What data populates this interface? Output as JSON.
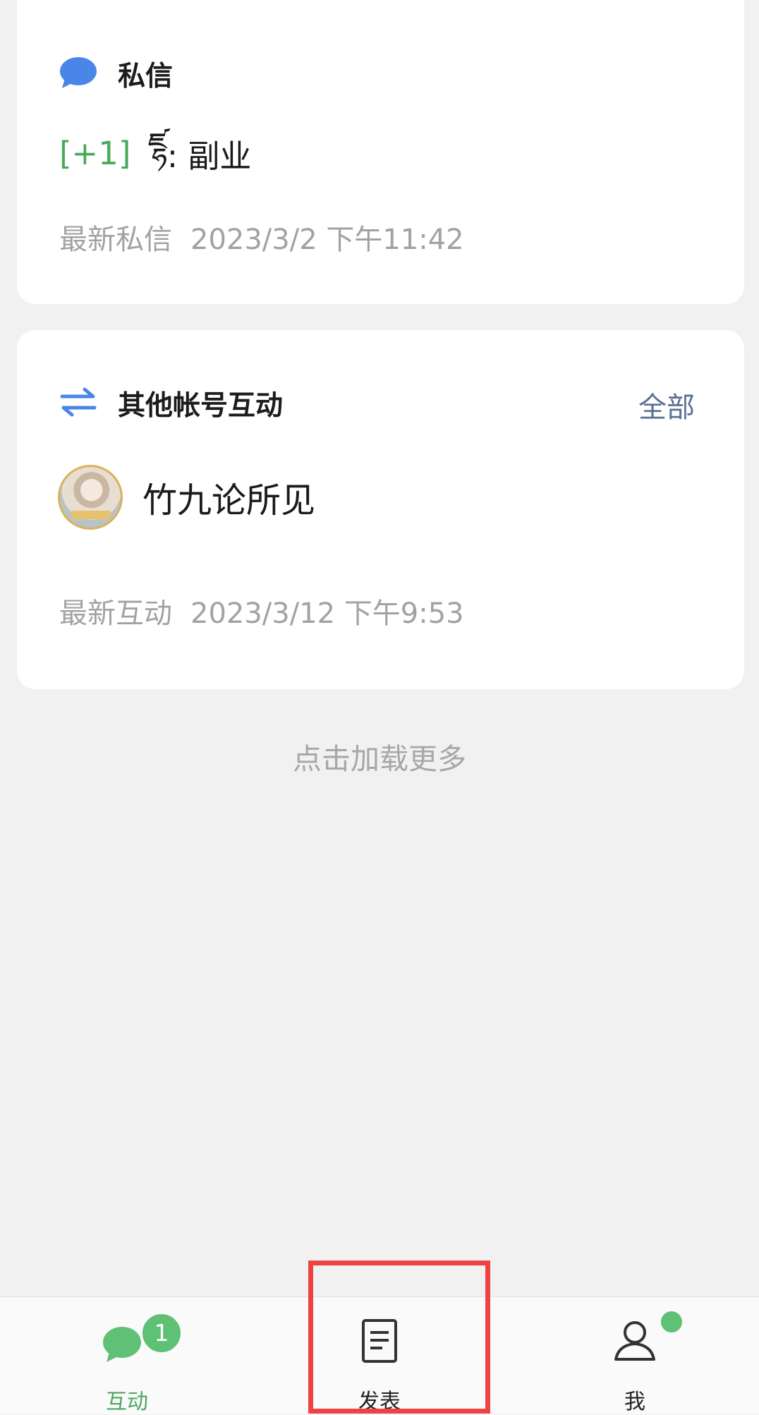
{
  "dm_card": {
    "title": "私信",
    "icon": "chat-bubble-icon",
    "count_label": "[+1]",
    "sender": "ཛྷ",
    "message": ": 副业",
    "latest_label": "最新私信",
    "latest_time": "2023/3/2 下午11:42"
  },
  "other_accounts_card": {
    "title": "其他帐号互动",
    "icon": "switch-arrows-icon",
    "see_all_label": "全部",
    "account_name": "竹九论所见",
    "latest_label": "最新互动",
    "latest_time": "2023/3/12 下午9:53"
  },
  "load_more_label": "点击加载更多",
  "tabs": [
    {
      "label": "互动",
      "icon": "chat-bubbles-icon",
      "badge": "1",
      "active": true
    },
    {
      "label": "发表",
      "icon": "document-icon",
      "active": false
    },
    {
      "label": "我",
      "icon": "person-icon",
      "dot": true,
      "active": false
    }
  ],
  "colors": {
    "accent_green": "#4aa85c",
    "link_blue": "#5a6f93",
    "icon_blue": "#4a86e8",
    "highlight_red": "#ef4343"
  }
}
